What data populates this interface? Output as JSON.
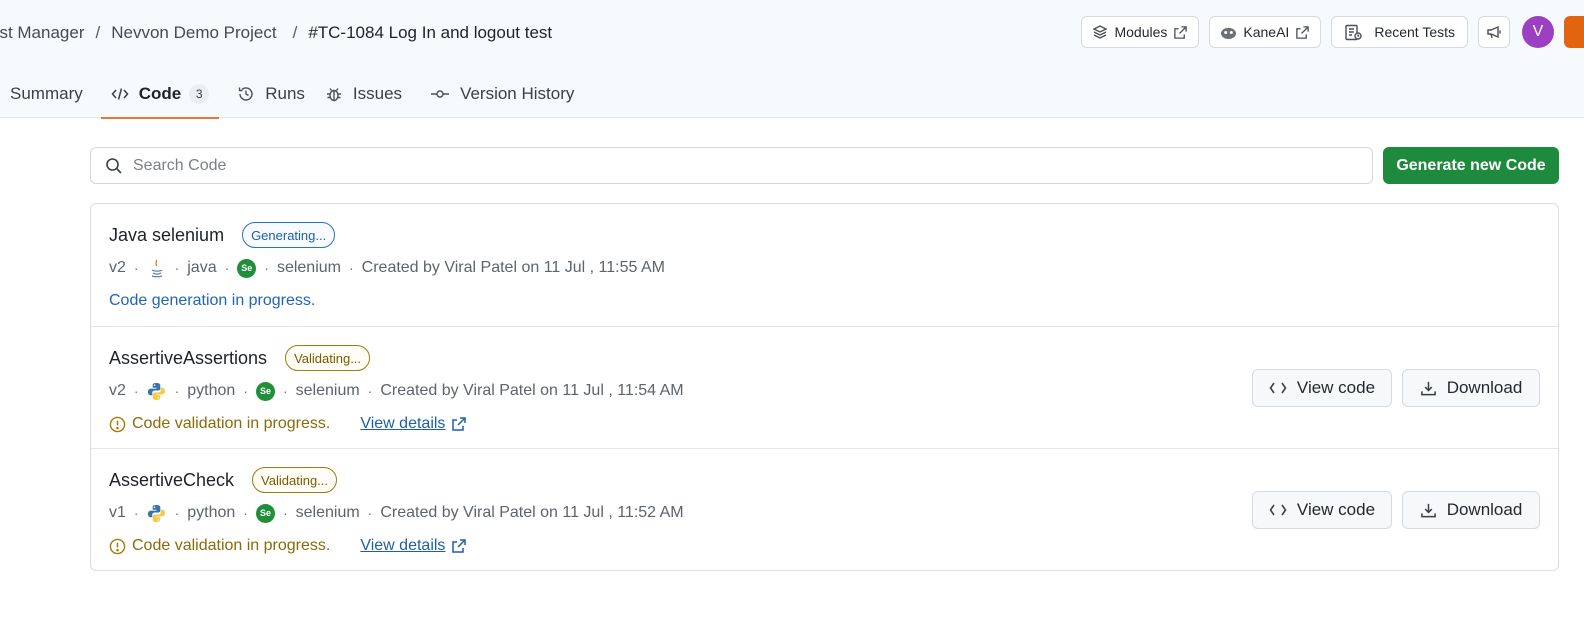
{
  "breadcrumb": {
    "items": [
      "est Manager",
      "Nevvon Demo Project"
    ],
    "current": "#TC-1084 Log In and logout test",
    "separator": "/"
  },
  "top_actions": {
    "modules": "Modules",
    "kaneai": "KaneAI",
    "recent_tests": "Recent Tests",
    "avatar_initial": "V"
  },
  "tabs": [
    {
      "label": "Summary",
      "icon": "summary-icon"
    },
    {
      "label": "Code",
      "icon": "code-icon",
      "count": "3",
      "active": true
    },
    {
      "label": "Runs",
      "icon": "history-icon"
    },
    {
      "label": "Issues",
      "icon": "bug-icon"
    },
    {
      "label": "Version History",
      "icon": "commit-icon"
    }
  ],
  "search": {
    "placeholder": "Search Code",
    "value": ""
  },
  "generate_button": "Generate new Code",
  "rows": [
    {
      "name": "Java selenium",
      "badge": "Generating...",
      "version": "v2",
      "language": "java",
      "framework": "selenium",
      "created": "Created by Viral Patel on 11 Jul , 11:55 AM",
      "status": "Code generation in progress."
    },
    {
      "name": "AssertiveAssertions",
      "badge": "Validating...",
      "version": "v2",
      "language": "python",
      "framework": "selenium",
      "created": "Created by Viral Patel on 11 Jul , 11:54 AM",
      "status": "Code validation in progress.",
      "details": "View details",
      "view": "View code",
      "download": "Download"
    },
    {
      "name": "AssertiveCheck",
      "badge": "Validating...",
      "version": "v1",
      "language": "python",
      "framework": "selenium",
      "created": "Created by Viral Patel on 11 Jul , 11:52 AM",
      "status": "Code validation in progress.",
      "details": "View details",
      "view": "View code",
      "download": "Download"
    }
  ],
  "dot_char": "·",
  "selenium_glyph": "Se",
  "colors": {
    "primary_green": "#1e8a3e",
    "active_tab_underline": "#e8773a",
    "link_blue": "#1c5fae",
    "warning_amber": "#8b6a08",
    "avatar_purple": "#9c3fc0"
  }
}
